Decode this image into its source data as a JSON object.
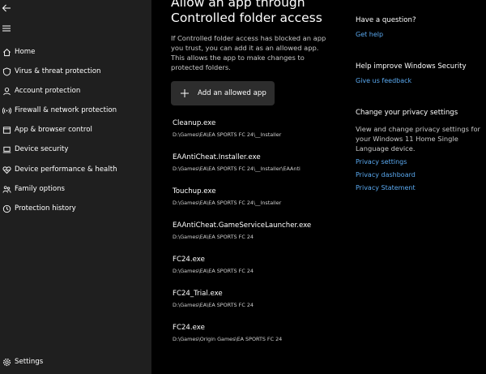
{
  "sidebar": {
    "items": [
      {
        "icon": "home-icon",
        "label": "Home"
      },
      {
        "icon": "shield-icon",
        "label": "Virus & threat protection"
      },
      {
        "icon": "person-icon",
        "label": "Account protection"
      },
      {
        "icon": "wifi-signal-icon",
        "label": "Firewall & network protection"
      },
      {
        "icon": "app-window-icon",
        "label": "App & browser control"
      },
      {
        "icon": "laptop-icon",
        "label": "Device security"
      },
      {
        "icon": "heart-icon",
        "label": "Device performance & health"
      },
      {
        "icon": "family-icon",
        "label": "Family options"
      },
      {
        "icon": "history-icon",
        "label": "Protection history"
      }
    ],
    "settings_label": "Settings"
  },
  "main": {
    "title_line1": "Allow an app through",
    "title_line2": "Controlled folder access",
    "description": "If Controlled folder access has blocked an app you trust, you can add it as an allowed app. This allows the app to make changes to protected folders.",
    "add_button_label": "Add an allowed app",
    "apps": [
      {
        "name": "Cleanup.exe",
        "path": "D:\\Games\\EA\\EA SPORTS FC 24\\__Installer"
      },
      {
        "name": "EAAntiCheat.Installer.exe",
        "path": "D:\\Games\\EA\\EA SPORTS FC 24\\__Installer\\EAAnti"
      },
      {
        "name": "Touchup.exe",
        "path": "D:\\Games\\EA\\EA SPORTS FC 24\\__Installer"
      },
      {
        "name": "EAAntiCheat.GameServiceLauncher.exe",
        "path": "D:\\Games\\EA\\EA SPORTS FC 24"
      },
      {
        "name": "FC24.exe",
        "path": "D:\\Games\\EA\\EA SPORTS FC 24"
      },
      {
        "name": "FC24_Trial.exe",
        "path": "D:\\Games\\EA\\EA SPORTS FC 24"
      },
      {
        "name": "FC24.exe",
        "path": "D:\\Games\\Origin Games\\EA SPORTS FC 24"
      }
    ]
  },
  "right_panel": {
    "question_heading": "Have a question?",
    "get_help_link": "Get help",
    "improve_heading": "Help improve Windows Security",
    "feedback_link": "Give us feedback",
    "privacy_heading": "Change your privacy settings",
    "privacy_text": "View and change privacy settings for your Windows 11 Home Single Language device.",
    "privacy_links": [
      "Privacy settings",
      "Privacy dashboard",
      "Privacy Statement"
    ]
  },
  "colors": {
    "sidebar_bg": "#1f1f1f",
    "main_bg": "#000000",
    "button_bg": "#2d2d2d",
    "link": "#5aa9f0"
  }
}
